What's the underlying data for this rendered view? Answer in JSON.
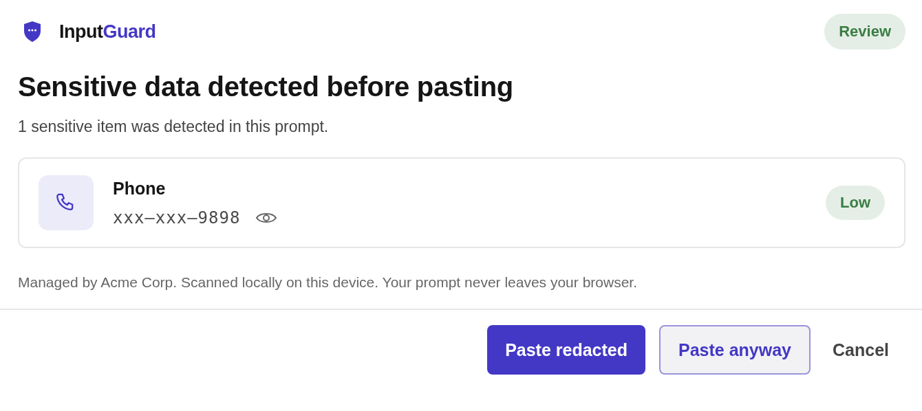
{
  "brand": {
    "prefix": "Input",
    "accent": "Guard"
  },
  "status_badge": {
    "label": "Review",
    "color": "#3a7d44"
  },
  "title": "Sensitive data detected before pasting",
  "subtitle": "1 sensitive item was detected in this prompt.",
  "items": [
    {
      "kind": "phone",
      "label": "Phone",
      "value": "xxx–xxx–9898",
      "revealed": false,
      "severity": "Low",
      "color": "#3a7d44"
    }
  ],
  "note": "Managed by Acme Corp. Scanned locally on this device. Your prompt never leaves your browser.",
  "buttons": [
    {
      "kind": "primary",
      "label": "Paste redacted"
    },
    {
      "kind": "secondary",
      "label": "Paste anyway"
    },
    {
      "kind": "text",
      "label": "Cancel"
    }
  ]
}
